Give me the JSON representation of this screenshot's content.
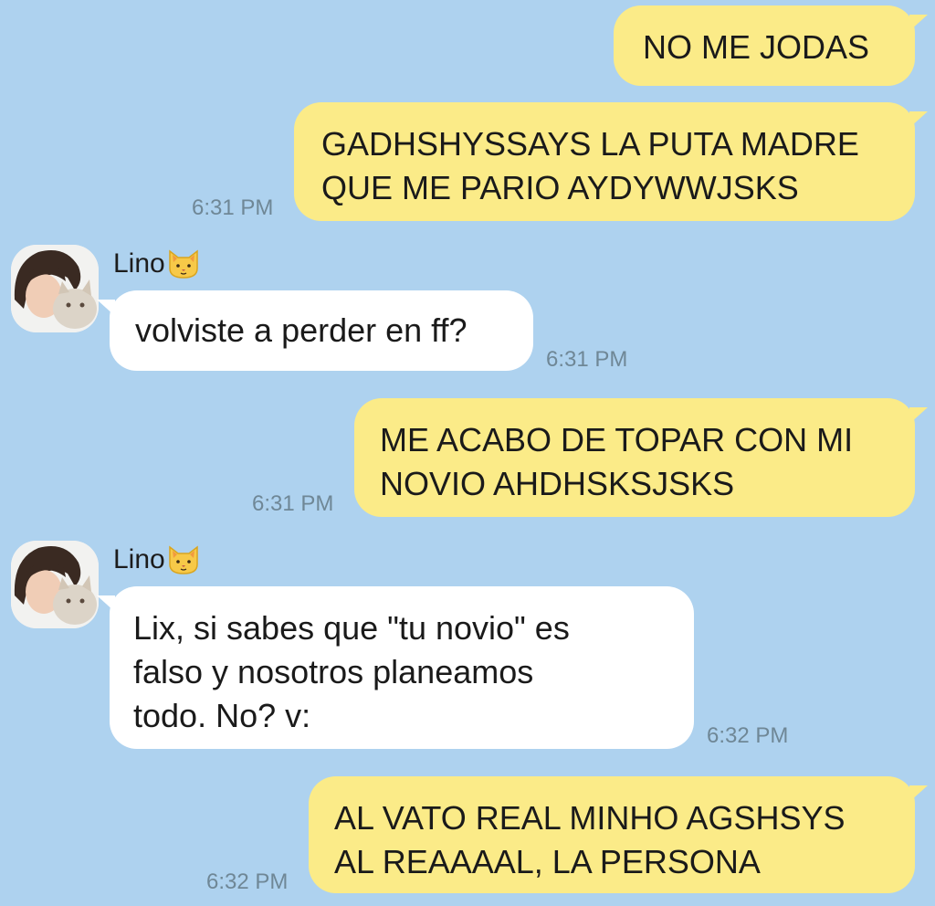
{
  "chat": {
    "contact": {
      "name": "Lino",
      "name_icon": "cat-face-icon"
    },
    "messages": [
      {
        "from": "me",
        "text": "NO ME JODAS",
        "time": ""
      },
      {
        "from": "me",
        "text": "GADHSHYSSAYS LA PUTA MADRE\nQUE ME PARIO AYDYWWJSKS",
        "time": "6:31 PM"
      },
      {
        "from": "them",
        "sender": "Lino",
        "text": "volviste a perder en ff?",
        "time": "6:31 PM"
      },
      {
        "from": "me",
        "text": "ME ACABO DE TOPAR CON MI\nNOVIO AHDHSKSJSKS",
        "time": "6:31 PM"
      },
      {
        "from": "them",
        "sender": "Lino",
        "text": "Lix, si sabes que \"tu novio\" es\nfalso y nosotros planeamos\ntodo. No? v:",
        "time": "6:32 PM"
      },
      {
        "from": "me",
        "text": "AL VATO REAL MINHO AGSHSYS\nAL REAAAAL, LA PERSONA",
        "time": "6:32 PM"
      }
    ]
  },
  "colors": {
    "background": "#aed2ef",
    "outgoing_bubble": "#fbeb88",
    "incoming_bubble": "#ffffff",
    "timestamp": "#6f8796"
  }
}
